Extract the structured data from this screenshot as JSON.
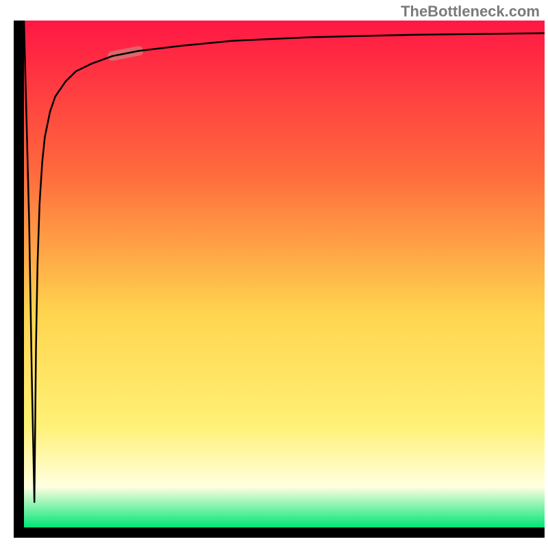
{
  "attribution": "TheBottleneck.com",
  "chart_data": {
    "type": "line",
    "title": "",
    "xlabel": "",
    "ylabel": "",
    "xlim": [
      0,
      100
    ],
    "ylim": [
      0,
      100
    ],
    "series": [
      {
        "name": "bottleneck-curve",
        "x": [
          0,
          1.0,
          1.5,
          2,
          2.1,
          2.3,
          2.6,
          3,
          3.5,
          4,
          5,
          6,
          8,
          10,
          13,
          17,
          22,
          30,
          40,
          55,
          75,
          100
        ],
        "y": [
          100,
          60,
          30,
          5,
          15,
          35,
          52,
          64,
          72,
          77,
          82,
          85,
          88,
          90,
          91.5,
          93,
          94,
          95,
          96,
          96.7,
          97.2,
          97.5
        ]
      }
    ],
    "highlight_segment": {
      "x": [
        17,
        22
      ],
      "y": [
        93,
        94
      ]
    },
    "background_gradient": {
      "top": "#ff1744",
      "mid_upper": "#ff6a3d",
      "mid": "#ffd54f",
      "mid_lower": "#fff176",
      "lower_white": "#ffffe0",
      "bottom": "#00e676"
    },
    "colors": {
      "curve": "#000000",
      "highlight": "#d17b7b",
      "axis": "#000000"
    }
  }
}
